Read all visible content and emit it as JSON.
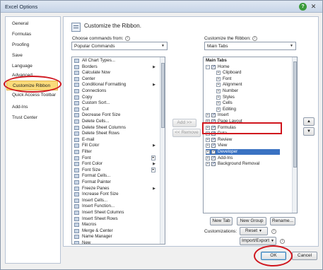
{
  "window": {
    "title": "Excel Options",
    "help_glyph": "?",
    "close_glyph": "✕"
  },
  "sidebar": {
    "items": [
      {
        "label": "General"
      },
      {
        "label": "Formulas"
      },
      {
        "label": "Proofing"
      },
      {
        "label": "Save"
      },
      {
        "label": "Language"
      },
      {
        "label": "Advanced"
      },
      {
        "label": "Customize Ribbon",
        "selected": true
      },
      {
        "label": "Quick Access Toolbar"
      },
      {
        "label": "Add-Ins"
      },
      {
        "label": "Trust Center"
      }
    ]
  },
  "header": {
    "title": "Customize the Ribbon.",
    "icon": "ribbon-customize-icon"
  },
  "commands": {
    "label": "Choose commands from:",
    "dropdown_value": "Popular Commands",
    "items": [
      {
        "label": "All Chart Types...",
        "icon": "chart-icon"
      },
      {
        "label": "Borders",
        "icon": "borders-icon",
        "submenu": true
      },
      {
        "label": "Calculate Now",
        "icon": "calculate-icon"
      },
      {
        "label": "Center",
        "icon": "center-icon"
      },
      {
        "label": "Conditional Formatting",
        "icon": "conditional-formatting-icon",
        "submenu": true
      },
      {
        "label": "Connections",
        "icon": "connections-icon"
      },
      {
        "label": "Copy",
        "icon": "copy-icon"
      },
      {
        "label": "Custom Sort...",
        "icon": "sort-icon"
      },
      {
        "label": "Cut",
        "icon": "cut-icon"
      },
      {
        "label": "Decrease Font Size",
        "icon": "decrease-font-icon"
      },
      {
        "label": "Delete Cells...",
        "icon": "delete-cells-icon"
      },
      {
        "label": "Delete Sheet Columns",
        "icon": "delete-columns-icon"
      },
      {
        "label": "Delete Sheet Rows",
        "icon": "delete-rows-icon"
      },
      {
        "label": "E-mail",
        "icon": "email-icon"
      },
      {
        "label": "Fill Color",
        "icon": "fill-color-icon",
        "submenu": true
      },
      {
        "label": "Filter",
        "icon": "filter-icon"
      },
      {
        "label": "Font",
        "icon": "font-icon",
        "split": true
      },
      {
        "label": "Font Color",
        "icon": "font-color-icon",
        "submenu": true
      },
      {
        "label": "Font Size",
        "icon": "font-size-icon",
        "split": true
      },
      {
        "label": "Format Cells...",
        "icon": "format-cells-icon"
      },
      {
        "label": "Format Painter",
        "icon": "format-painter-icon"
      },
      {
        "label": "Freeze Panes",
        "icon": "freeze-panes-icon",
        "submenu": true
      },
      {
        "label": "Increase Font Size",
        "icon": "increase-font-icon"
      },
      {
        "label": "Insert Cells...",
        "icon": "insert-cells-icon"
      },
      {
        "label": "Insert Function...",
        "icon": "insert-function-icon"
      },
      {
        "label": "Insert Sheet Columns",
        "icon": "insert-columns-icon"
      },
      {
        "label": "Insert Sheet Rows",
        "icon": "insert-rows-icon"
      },
      {
        "label": "Macros",
        "icon": "macros-icon"
      },
      {
        "label": "Merge & Center",
        "icon": "merge-center-icon"
      },
      {
        "label": "Name Manager",
        "icon": "name-manager-icon"
      },
      {
        "label": "New",
        "icon": "new-icon"
      }
    ]
  },
  "middle_buttons": {
    "add": "Add >>",
    "remove": "<< Remove"
  },
  "ribbon": {
    "label": "Customize the Ribbon:",
    "dropdown_value": "Main Tabs",
    "group_header": "Main Tabs",
    "tree": [
      {
        "label": "Home",
        "level": 0,
        "expander": "⊟",
        "checked": true
      },
      {
        "label": "Clipboard",
        "level": 1,
        "expander": "⊞"
      },
      {
        "label": "Font",
        "level": 1,
        "expander": "⊞"
      },
      {
        "label": "Alignment",
        "level": 1,
        "expander": "⊞"
      },
      {
        "label": "Number",
        "level": 1,
        "expander": "⊞"
      },
      {
        "label": "Styles",
        "level": 1,
        "expander": "⊞"
      },
      {
        "label": "Cells",
        "level": 1,
        "expander": "⊞"
      },
      {
        "label": "Editing",
        "level": 1,
        "expander": "⊞"
      },
      {
        "label": "Insert",
        "level": 0,
        "expander": "⊞",
        "checked": true
      },
      {
        "label": "Page Layout",
        "level": 0,
        "expander": "⊞",
        "checked": true
      },
      {
        "label": "Formulas",
        "level": 0,
        "expander": "⊞",
        "checked": true
      },
      {
        "label": "Data",
        "level": 0,
        "expander": "⊞",
        "checked": true
      },
      {
        "label": "Review",
        "level": 0,
        "expander": "⊞",
        "checked": true
      },
      {
        "label": "View",
        "level": 0,
        "expander": "⊞",
        "checked": true
      },
      {
        "label": "Developer",
        "level": 0,
        "expander": "⊞",
        "checked": true,
        "selected": true
      },
      {
        "label": "Add-Ins",
        "level": 0,
        "expander": "⊞",
        "checked": true
      },
      {
        "label": "Background Removal",
        "level": 0,
        "expander": "⊞",
        "checked": true
      }
    ],
    "move_up_glyph": "▲",
    "move_down_glyph": "▼"
  },
  "bottom": {
    "new_tab": "New Tab",
    "new_group": "New Group",
    "rename": "Rename...",
    "customizations_label": "Customizations:",
    "reset": "Reset",
    "import_export": "Import/Export",
    "ok": "OK",
    "cancel": "Cancel"
  },
  "colors": {
    "selected_nav": "#fadb7a",
    "selection_blue": "#3a72c2",
    "annotation_red": "#d0161e"
  }
}
